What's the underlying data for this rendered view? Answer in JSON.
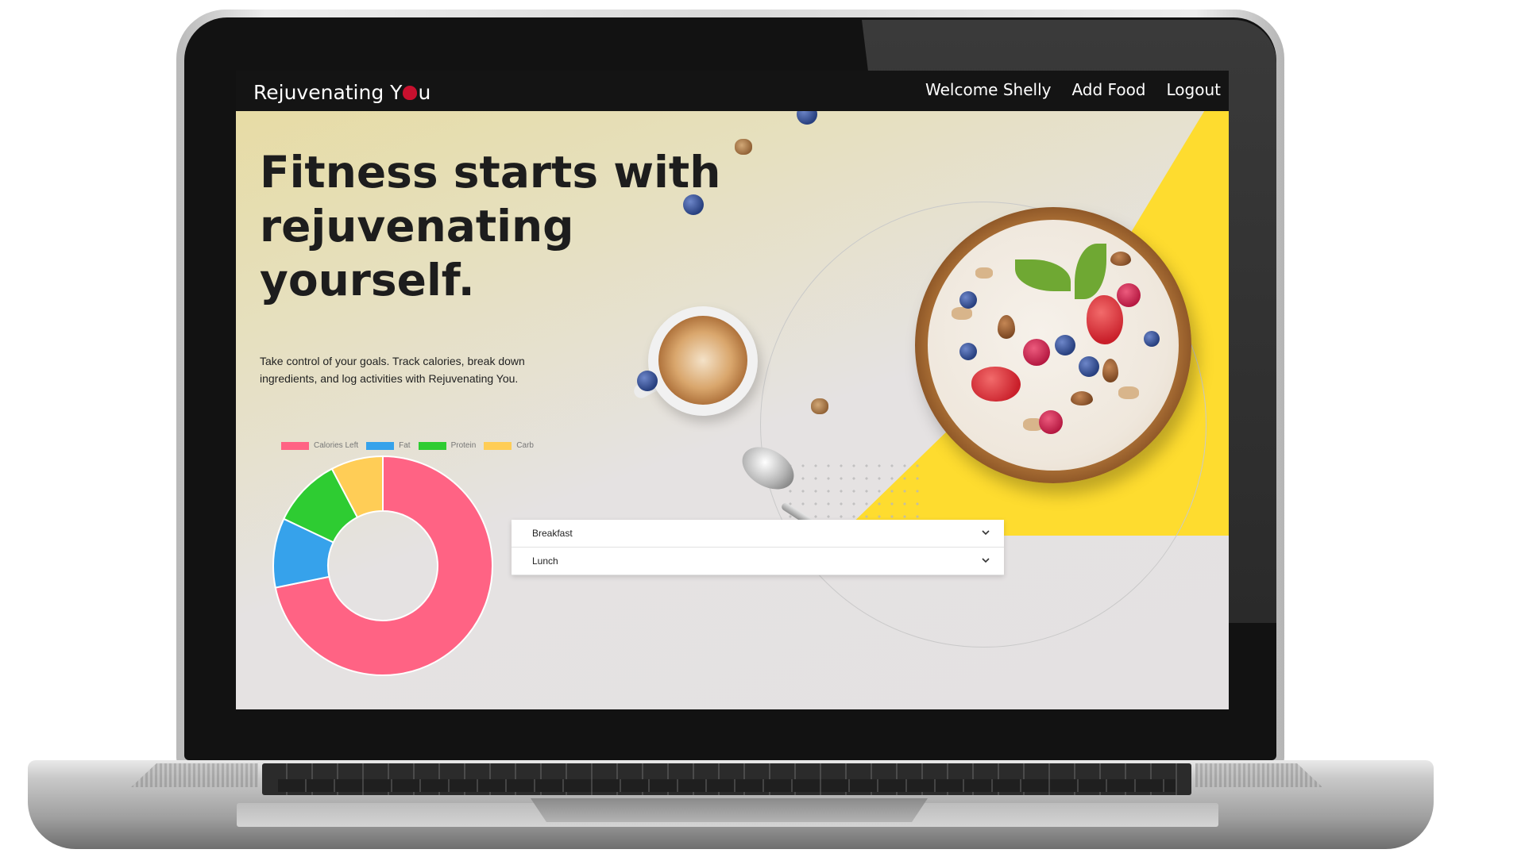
{
  "navbar": {
    "brand_prefix": "Rejuvenating Y",
    "brand_suffix": "u",
    "links": [
      "Welcome Shelly",
      "Add Food",
      "Logout"
    ]
  },
  "hero": {
    "title": "Fitness starts with rejuvenating yourself.",
    "subtitle": "Take control of your goals. Track calories, break down ingredients, and log activities with Rejuvenating You."
  },
  "chart_data": {
    "type": "pie",
    "variant": "doughnut",
    "categories": [
      "Calories Left",
      "Fat",
      "Protein",
      "Carb"
    ],
    "values": [
      70,
      10,
      10,
      7.5
    ],
    "colors": [
      "#ff6384",
      "#36a2eb",
      "#2ecc32",
      "#ffcd56"
    ],
    "legend": "top"
  },
  "accordion": {
    "items": [
      {
        "label": "Breakfast"
      },
      {
        "label": "Lunch"
      }
    ]
  },
  "icons": {
    "brand_apple": "apple-icon",
    "accordion_chevron": "chevron-down-icon"
  }
}
